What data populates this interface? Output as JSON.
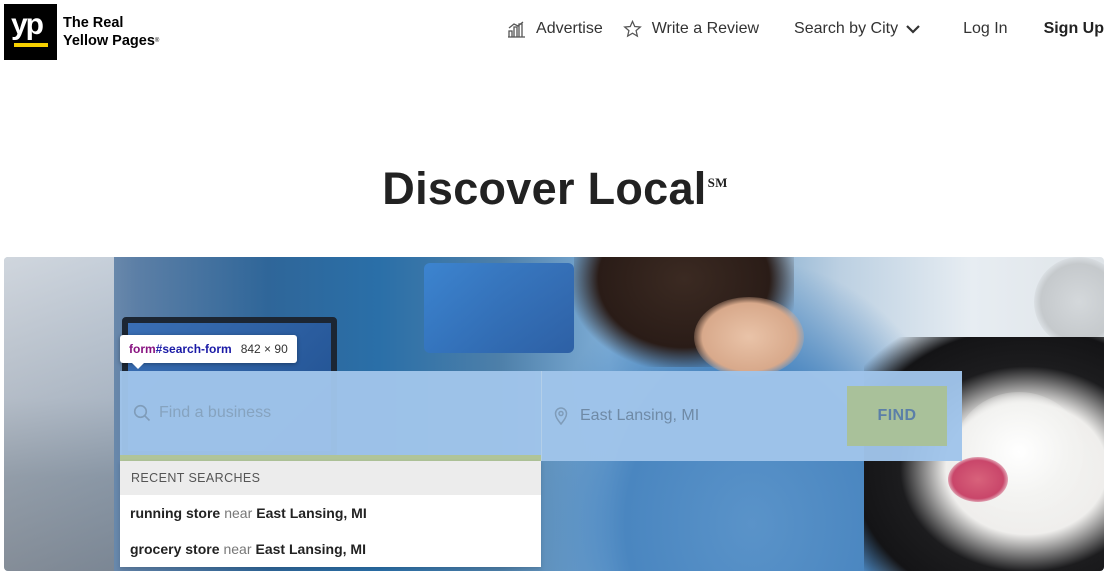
{
  "brand": {
    "logo_glyph": "yp",
    "name_line1": "The Real",
    "name_line2": "Yellow Pages",
    "trademark": "®",
    "accent_color": "#f6d000"
  },
  "nav": {
    "advertise": "Advertise",
    "write_review": "Write a Review",
    "search_by_city": "Search by City",
    "login": "Log In",
    "signup": "Sign Up"
  },
  "headline": {
    "title": "Discover Local",
    "mark": "SM"
  },
  "devtools_tooltip": {
    "tag": "form",
    "id": "#search-form",
    "dims": "842 × 90"
  },
  "search": {
    "what_placeholder": "Find a business",
    "where_value": "East Lansing, MI",
    "find_label": "FIND"
  },
  "recent": {
    "header": "RECENT SEARCHES",
    "items": [
      {
        "term": "running store",
        "near": "near",
        "location": "East Lansing, MI"
      },
      {
        "term": "grocery store",
        "near": "near",
        "location": "East Lansing, MI"
      }
    ]
  },
  "icons": [
    "advertise-chart-icon",
    "star-outline-icon",
    "chevron-down-icon",
    "search-icon",
    "location-pin-icon"
  ]
}
